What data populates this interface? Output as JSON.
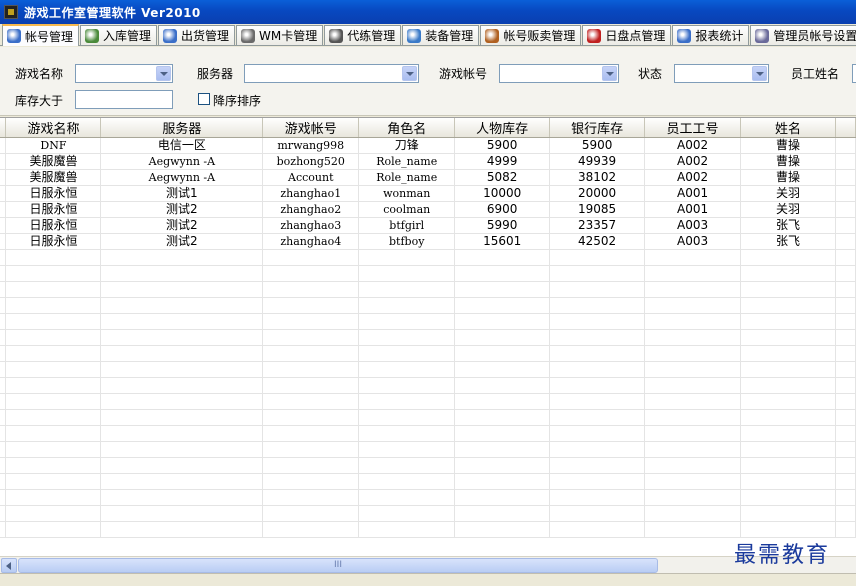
{
  "window": {
    "title": "游戏工作室管理软件 Ver2010"
  },
  "tabs": [
    {
      "label": "帐号管理",
      "icon": "account-icon",
      "active": true
    },
    {
      "label": "入库管理",
      "icon": "stock-in-icon"
    },
    {
      "label": "出货管理",
      "icon": "shipment-icon"
    },
    {
      "label": "WM卡管理",
      "icon": "card-icon"
    },
    {
      "label": "代练管理",
      "icon": "leveling-icon"
    },
    {
      "label": "装备管理",
      "icon": "equipment-icon"
    },
    {
      "label": "帐号贩卖管理",
      "icon": "account-sale-icon"
    },
    {
      "label": "日盘点管理",
      "icon": "daily-check-icon"
    },
    {
      "label": "报表统计",
      "icon": "report-icon"
    },
    {
      "label": "管理员帐号设置",
      "icon": "admin-settings-icon"
    }
  ],
  "filters": {
    "game_name": {
      "label": "游戏名称",
      "value": ""
    },
    "server": {
      "label": "服务器",
      "value": ""
    },
    "game_account": {
      "label": "游戏帐号",
      "value": ""
    },
    "status": {
      "label": "状态",
      "value": ""
    },
    "employee_name": {
      "label": "员工姓名"
    },
    "stock_greater": {
      "label": "库存大于",
      "value": ""
    },
    "desc_sort": {
      "label": "降序排序",
      "checked": false
    }
  },
  "table": {
    "columns": [
      "游戏名称",
      "服务器",
      "游戏帐号",
      "角色名",
      "人物库存",
      "银行库存",
      "员工工号",
      "姓名"
    ],
    "rows": [
      [
        "DNF",
        "电信一区",
        "mrwang998",
        "刀锋",
        "5900",
        "5900",
        "A002",
        "曹操"
      ],
      [
        "美服魔兽",
        "Aegwynn -A",
        "bozhong520",
        "Role_name",
        "4999",
        "49939",
        "A002",
        "曹操"
      ],
      [
        "美服魔兽",
        "Aegwynn -A",
        "Account",
        "Role_name",
        "5082",
        "38102",
        "A002",
        "曹操"
      ],
      [
        "日服永恒",
        "测试1",
        "zhanghao1",
        "wonman",
        "10000",
        "20000",
        "A001",
        "关羽"
      ],
      [
        "日服永恒",
        "测试2",
        "zhanghao2",
        "coolman",
        "6900",
        "19085",
        "A001",
        "关羽"
      ],
      [
        "日服永恒",
        "测试2",
        "zhanghao3",
        "btfgirl",
        "5990",
        "23357",
        "A003",
        "张飞"
      ],
      [
        "日服永恒",
        "测试2",
        "zhanghao4",
        "btfboy",
        "15601",
        "42502",
        "A003",
        "张飞"
      ]
    ]
  },
  "scrollbar": {
    "thumb_grip": "III"
  },
  "watermark": "最需教育",
  "colors": {
    "titlebar": "#0a4ac4",
    "active_tab_accent": "#f7b94f",
    "input_border": "#7f9db9"
  }
}
